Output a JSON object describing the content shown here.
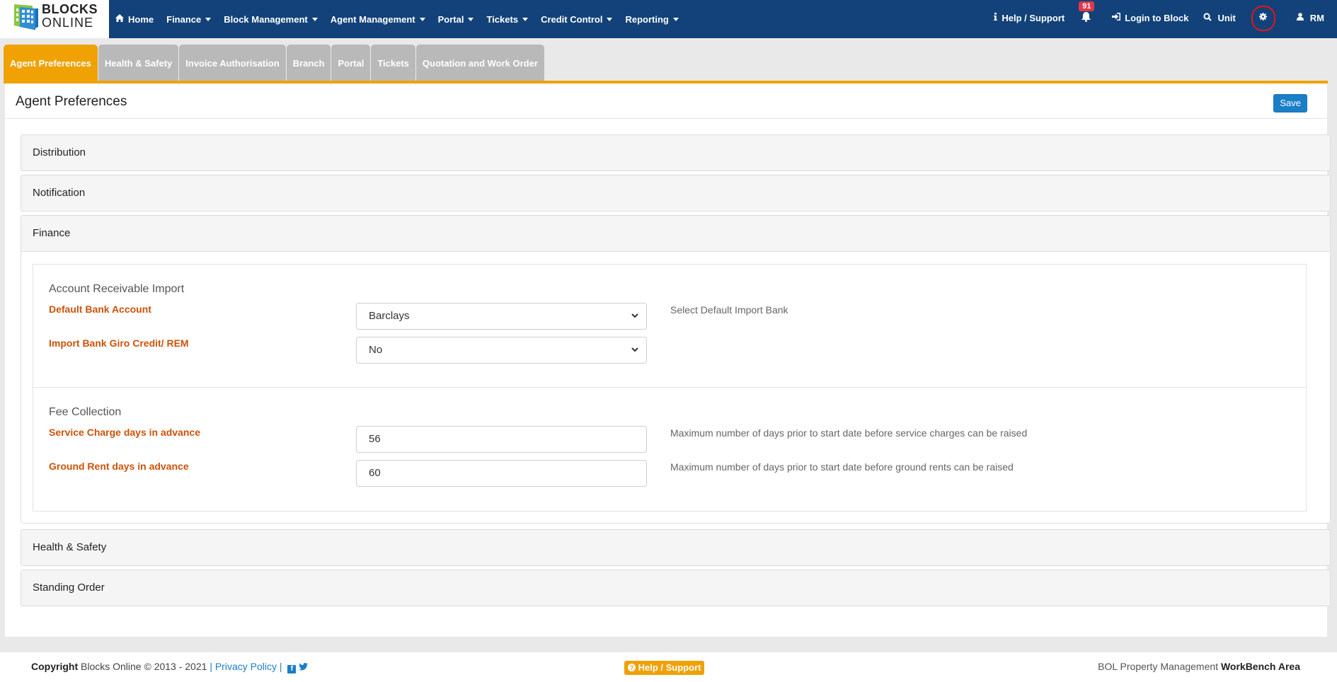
{
  "brand": {
    "line1": "BLOCKS",
    "line2": "ONLINE"
  },
  "nav": {
    "home": "Home",
    "finance": "Finance",
    "block_management": "Block Management",
    "agent_management": "Agent Management",
    "portal": "Portal",
    "tickets": "Tickets",
    "credit_control": "Credit Control",
    "reporting": "Reporting",
    "help_support": "Help / Support",
    "notification_count": "91",
    "login_to_block": "Login to Block",
    "unit": "Unit",
    "user": "RM"
  },
  "tabs": [
    {
      "label": "Agent Preferences",
      "active": true
    },
    {
      "label": "Health & Safety"
    },
    {
      "label": "Invoice Authorisation"
    },
    {
      "label": "Branch"
    },
    {
      "label": "Portal"
    },
    {
      "label": "Tickets"
    },
    {
      "label": "Quotation and Work Order"
    }
  ],
  "page": {
    "title": "Agent Preferences",
    "save_label": "Save"
  },
  "accordion": {
    "distribution": "Distribution",
    "notification": "Notification",
    "finance": "Finance",
    "health_safety": "Health & Safety",
    "standing_order": "Standing Order"
  },
  "finance": {
    "ar_import": {
      "title": "Account Receivable Import",
      "default_bank_label": "Default Bank Account",
      "default_bank_value": "Barclays",
      "default_bank_help": "Select Default Import Bank",
      "giro_label": "Import Bank Giro Credit/ REM",
      "giro_value": "No"
    },
    "fee_collection": {
      "title": "Fee Collection",
      "service_charge_label": "Service Charge days in advance",
      "service_charge_value": "56",
      "service_charge_help": "Maximum number of days prior to start date before service charges can be raised",
      "ground_rent_label": "Ground Rent days in advance",
      "ground_rent_value": "60",
      "ground_rent_help": "Maximum number of days prior to start date before ground rents can be raised"
    }
  },
  "footer": {
    "copyright_label": "Copyright",
    "copyright_text": "Blocks Online © 2013 - 2021",
    "sep": "|",
    "privacy": "Privacy Policy",
    "help_support": "Help / Support",
    "right_text": "BOL Property Management",
    "right_bold": "WorkBench Area"
  },
  "colors": {
    "navbar": "#124279",
    "accent_orange": "#f0a104",
    "label_orange": "#cc5209",
    "save_blue": "#1b7fc8",
    "badge_red": "#e0374b"
  },
  "icons": [
    "home-icon",
    "info-icon",
    "bell-icon",
    "sign-in-icon",
    "search-icon",
    "gear-icon",
    "user-icon",
    "facebook-icon",
    "twitter-icon",
    "question-circle-icon",
    "chevron-down-icon"
  ]
}
